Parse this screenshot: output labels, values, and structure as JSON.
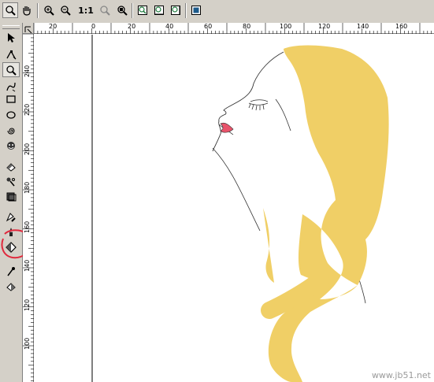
{
  "toolbar": {
    "items": [
      {
        "name": "zoom-tool-icon",
        "pressed": true
      },
      {
        "name": "pan-hand-icon",
        "pressed": false
      },
      {
        "name": "zoom-in-icon",
        "pressed": false
      },
      {
        "name": "zoom-out-icon",
        "pressed": false
      },
      {
        "name": "zoom-actual-size-icon",
        "label": "1:1"
      },
      {
        "name": "zoom-selected-icon",
        "pressed": false
      },
      {
        "name": "zoom-all-objects-icon",
        "pressed": false
      },
      {
        "name": "zoom-page-icon",
        "pressed": false
      },
      {
        "name": "zoom-page-width-icon",
        "pressed": false
      },
      {
        "name": "zoom-page-height-icon",
        "pressed": false
      },
      {
        "name": "full-screen-preview-icon",
        "pressed": false
      }
    ]
  },
  "toolbox": {
    "tools": [
      {
        "name": "pick-tool-icon"
      },
      {
        "name": "shape-tool-icon"
      },
      {
        "name": "zoom-tool-icon",
        "pressed": true
      },
      {
        "name": "freehand-tool-icon"
      },
      {
        "name": "rectangle-tool-icon"
      },
      {
        "name": "ellipse-tool-icon"
      },
      {
        "name": "spiral-tool-icon"
      },
      {
        "name": "basic-shapes-tool-icon"
      },
      {
        "name": "text-tool-icon"
      },
      {
        "name": "interactive-blend-tool-icon"
      },
      {
        "name": "eyedropper-tool-icon"
      },
      {
        "name": "outline-tool-icon"
      },
      {
        "name": "fill-tool-icon"
      },
      {
        "name": "interactive-fill-tool-icon",
        "highlighted": true
      },
      {
        "name": "interactive-mesh-fill-tool-icon"
      },
      {
        "name": "smart-fill-tool-icon"
      }
    ]
  },
  "rulers": {
    "horizontal_labels": [
      "20",
      "0",
      "20",
      "40",
      "60",
      "80",
      "100",
      "120",
      "140",
      "160"
    ],
    "vertical_labels": [
      "240",
      "220",
      "200",
      "180",
      "160",
      "140",
      "120",
      "100"
    ]
  },
  "drawing": {
    "hair_color": "#f0cf66",
    "lip_color": "#e8546b",
    "outline_color": "#333333",
    "annotation_color": "#e0283c"
  },
  "watermark": "www.jb51.net"
}
